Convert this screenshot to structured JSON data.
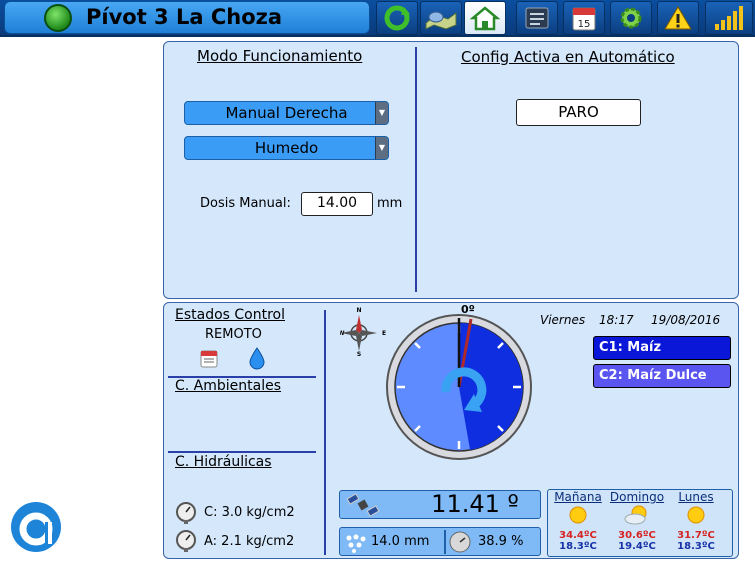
{
  "header": {
    "title": "Pívot 3 La Choza",
    "buttons": [
      {
        "name": "refresh-icon"
      },
      {
        "name": "map-icon"
      },
      {
        "name": "home-icon",
        "active": true
      },
      {
        "name": "list-icon"
      },
      {
        "name": "calendar-icon",
        "text": "15"
      },
      {
        "name": "gear-icon"
      },
      {
        "name": "warning-icon"
      },
      {
        "name": "signal-icon"
      }
    ]
  },
  "modo": {
    "title": "Modo Funcionamiento",
    "mode_select": "Manual Derecha",
    "type_select": "Humedo",
    "dose_label": "Dosis Manual:",
    "dose_value": "14.00",
    "dose_unit": "mm"
  },
  "config": {
    "title": "Config Activa en Automático",
    "status": "PARO"
  },
  "estados": {
    "title": "Estados Control",
    "mode": "REMOTO",
    "ambientales": "C. Ambientales",
    "hidraulicas": "C. Hidráulicas",
    "pressure_c": "C: 3.0 kg/cm2",
    "pressure_a": "A: 2.1 kg/cm2"
  },
  "compass": {
    "n": "N",
    "s": "S",
    "e": "E",
    "w": "W"
  },
  "dial": {
    "zero_label": "0º",
    "angle_deg": 170
  },
  "datetime": {
    "day": "Viernes",
    "time": "18:17",
    "date": "19/08/2016"
  },
  "crops": [
    {
      "label": "C1: Maíz",
      "color": "#0b17d8"
    },
    {
      "label": "C2: Maíz Dulce",
      "color": "#5a55f0"
    }
  ],
  "readouts": {
    "angle": "11.41 º",
    "water": "14.0 mm",
    "speed": "38.9 %"
  },
  "weather": [
    {
      "day": "Mañana",
      "icon": "sun-icon",
      "hi": "34.4ºC",
      "lo": "18.3ºC"
    },
    {
      "day": "Domingo",
      "icon": "partly-cloudy-icon",
      "hi": "30.6ºC",
      "lo": "19.4ºC"
    },
    {
      "day": "Lunes",
      "icon": "sun-icon",
      "hi": "31.7ºC",
      "lo": "18.3ºC"
    }
  ],
  "colors": {
    "accent": "#1e7fd6",
    "panel": "#d4e7fb",
    "dial_light": "#5e8bff",
    "dial_dark": "#0f2ee0"
  }
}
